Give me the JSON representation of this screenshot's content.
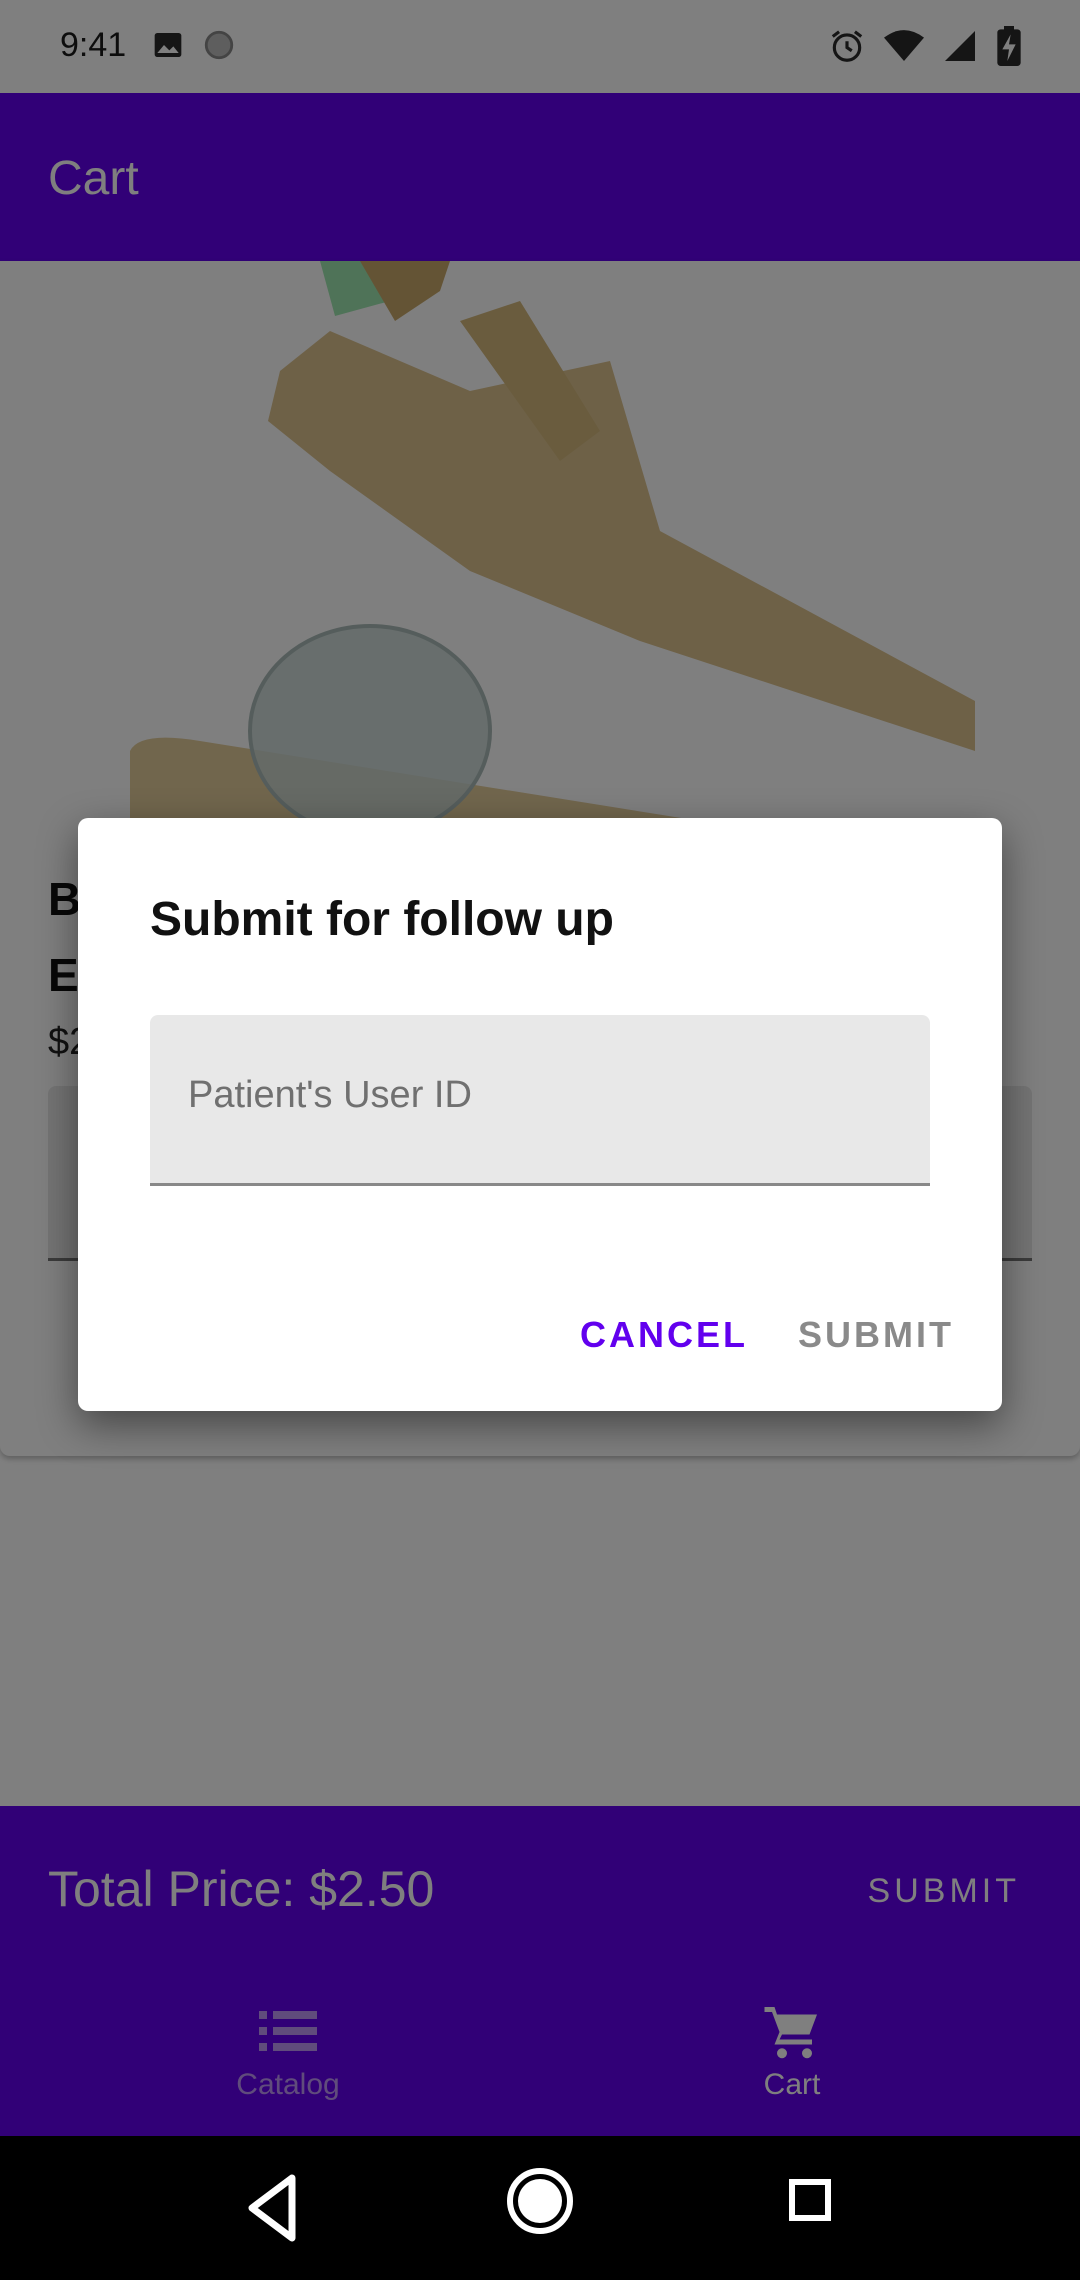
{
  "status_bar": {
    "time": "9:41",
    "left_icons": [
      "image-icon",
      "circle-icon"
    ],
    "right_icons": [
      "alarm-icon",
      "wifi-icon",
      "signal-icon",
      "battery-charging-icon"
    ]
  },
  "app_bar": {
    "title": "Cart"
  },
  "product": {
    "title": "B\nE",
    "price": "$2"
  },
  "bottom_panel": {
    "total_price": "Total Price: $2.50",
    "submit_label": "SUBMIT"
  },
  "bottom_nav": {
    "items": [
      {
        "label": "Catalog",
        "icon": "list-icon",
        "active": false
      },
      {
        "label": "Cart",
        "icon": "cart-icon",
        "active": true
      }
    ]
  },
  "dialog": {
    "title": "Submit for follow up",
    "field_placeholder": "Patient's User ID",
    "field_value": "",
    "cancel_label": "CANCEL",
    "submit_label": "SUBMIT"
  },
  "colors": {
    "primary": "#6200ee",
    "white": "#ffffff",
    "scrim": "rgba(0,0,0,0.5)",
    "disabled_text": "#8a8a8a"
  }
}
